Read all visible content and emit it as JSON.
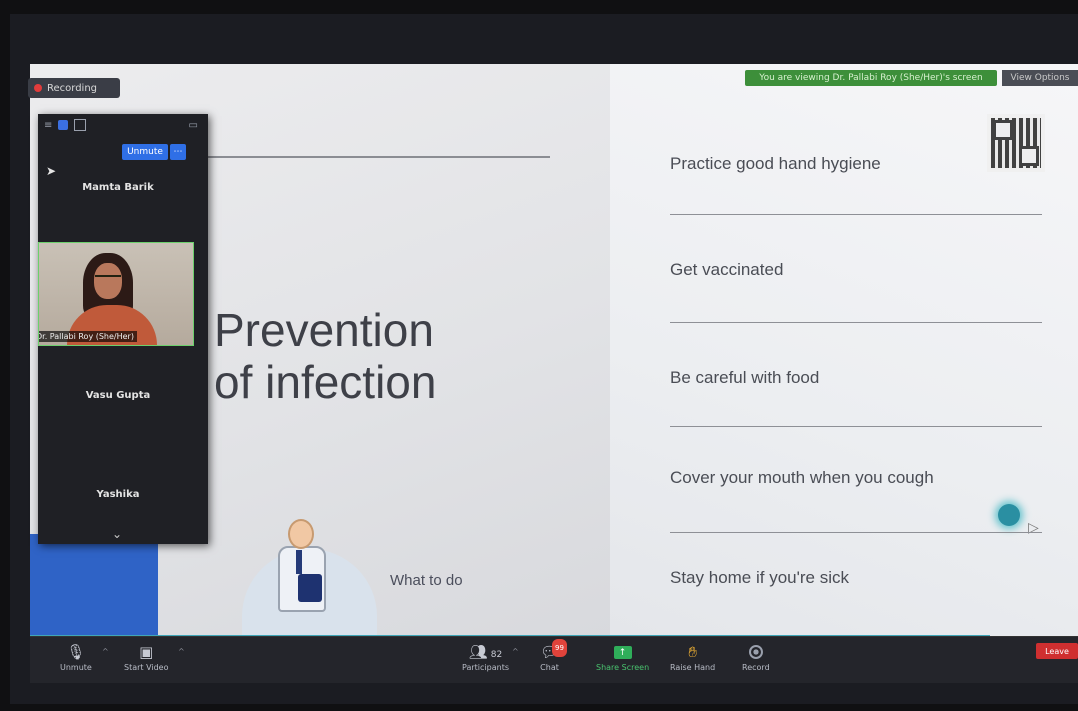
{
  "meeting": {
    "recording_label": "Recording",
    "share_banner": "You are viewing Dr. Pallabi Roy (She/Her)'s screen",
    "stop_label": "View Options"
  },
  "slide": {
    "title_line1": "Prevention",
    "title_line2": "of infection",
    "subtitle": "What to do",
    "items": [
      "Practice good hand hygiene",
      "Get vaccinated",
      "Be careful with food",
      "Cover your mouth when you cough",
      "Stay home if you're sick"
    ]
  },
  "panel": {
    "unmute_label": "Unmute",
    "participants": [
      {
        "name": "Mamta Barik"
      },
      {
        "name": "Dr. Pallabi Roy (She/Her)"
      },
      {
        "name": "Vasu Gupta"
      },
      {
        "name": "Yashika"
      }
    ]
  },
  "toolbar": {
    "unmute": "Unmute",
    "start_video": "Start Video",
    "participants": "Participants",
    "participants_count": "82",
    "chat": "Chat",
    "chat_badge": "99",
    "share_screen": "Share Screen",
    "raise_hand": "Raise Hand",
    "record": "Record",
    "leave": "Leave"
  },
  "colors": {
    "accent_blue": "#2f63c6",
    "progress": "#3fa6b8",
    "share_green": "#2fae5a",
    "leave_red": "#cf2f30"
  }
}
